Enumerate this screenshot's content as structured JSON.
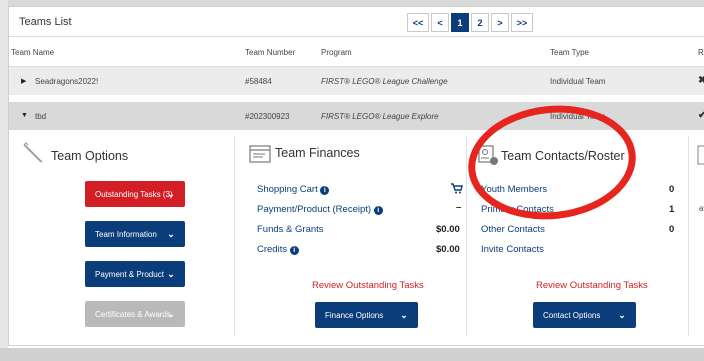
{
  "list": {
    "title": "Teams List",
    "pager": [
      "<<",
      "<",
      "1",
      "2",
      ">",
      ">>"
    ],
    "active_page": "1"
  },
  "columns": {
    "team_name": "Team Name",
    "team_number": "Team Number",
    "program": "Program",
    "team_type": "Team Type",
    "extra": "R"
  },
  "rows": [
    {
      "expand": "▶",
      "name": "Seadragons2022!",
      "number": "#58484",
      "program": "FIRST® LEGO® League Challenge",
      "type": "Individual Team",
      "mark": "✖"
    },
    {
      "expand": "▼",
      "name": "tbd",
      "number": "#202300923",
      "program": "FIRST® LEGO® League Explore",
      "type": "Individual Team",
      "mark": "✔"
    }
  ],
  "team_options": {
    "title": "Team Options",
    "buttons": [
      "Outstanding Tasks (3)",
      "Team Information",
      "Payment & Product",
      "Certificates & Awards"
    ]
  },
  "team_finances": {
    "title": "Team Finances",
    "items": [
      {
        "label": "Shopping Cart",
        "value": ""
      },
      {
        "label": "Payment/Product (Receipt)",
        "value": "–"
      },
      {
        "label": "Funds & Grants",
        "value": "$0.00"
      },
      {
        "label": "Credits",
        "value": "$0.00"
      }
    ],
    "review": "Review Outstanding Tasks",
    "button": "Finance Options"
  },
  "team_contacts": {
    "title": "Team Contacts/Roster",
    "items": [
      {
        "label": "Youth Members",
        "value": "0"
      },
      {
        "label": "Primary Contacts",
        "value": "1"
      },
      {
        "label": "Other Contacts",
        "value": "0"
      },
      {
        "label": "Invite Contacts",
        "value": ""
      }
    ],
    "review": "Review Outstanding Tasks",
    "button": "Contact Options"
  },
  "cut_text": "av",
  "colors": {
    "navy": "#0b3d7a",
    "red": "#d21f26",
    "gray": "#b9b9b9",
    "annotation": "#e7251f"
  }
}
